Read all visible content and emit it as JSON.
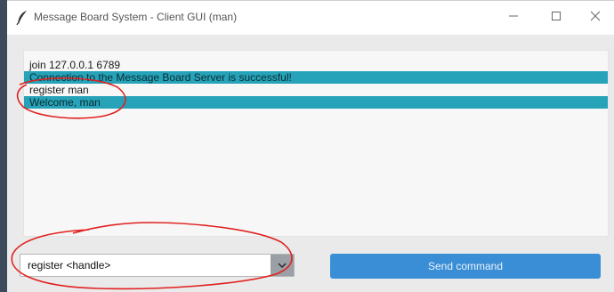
{
  "window": {
    "title": "Message Board System - Client GUI (man)",
    "controls": {
      "minimize_icon": "minimize-icon",
      "maximize_icon": "maximize-icon",
      "close_icon": "close-icon"
    },
    "app_icon": "feather-icon"
  },
  "messages": [
    {
      "text": "join 127.0.0.1 6789",
      "highlighted": false
    },
    {
      "text": "Connection to the Message Board Server is successful!",
      "highlighted": true
    },
    {
      "text": "register man",
      "highlighted": false
    },
    {
      "text": "Welcome, man",
      "highlighted": true
    }
  ],
  "command": {
    "selected": "register <handle>",
    "arrow_icon": "chevron-down-icon"
  },
  "send_button": {
    "label": "Send command"
  },
  "colors": {
    "highlight": "#26a3b8",
    "button": "#3a8ed6",
    "annotation": "#e0201f"
  }
}
